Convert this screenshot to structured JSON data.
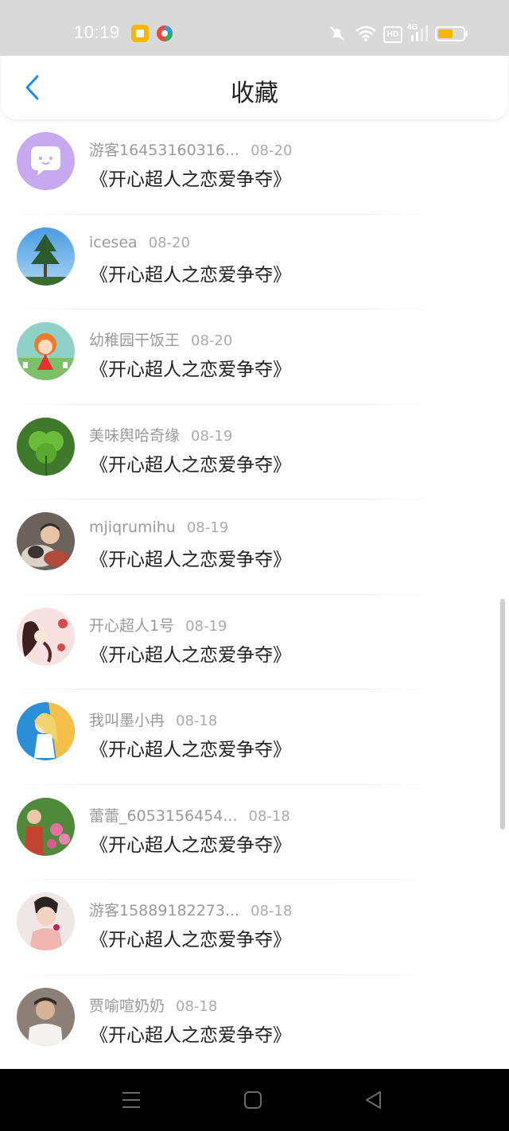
{
  "status_bar": {
    "time": "10:19",
    "hd_label": "HD",
    "network_label": "4G",
    "battery_color": "#f2b705"
  },
  "header": {
    "title": "收藏",
    "back_icon": "chevron-left-icon",
    "accent_color": "#1a8cff"
  },
  "favorites": [
    {
      "user": "游客16453160316...",
      "date": "08-20",
      "work": "《开心超人之恋爱争夺》"
    },
    {
      "user": "icesea",
      "date": "08-20",
      "work": "《开心超人之恋爱争夺》"
    },
    {
      "user": "幼稚园干饭王",
      "date": "08-20",
      "work": "《开心超人之恋爱争夺》"
    },
    {
      "user": "美味舆哈奇缘",
      "date": "08-19",
      "work": "《开心超人之恋爱争夺》"
    },
    {
      "user": "mjiqrumihu",
      "date": "08-19",
      "work": "《开心超人之恋爱争夺》"
    },
    {
      "user": "开心超人1号",
      "date": "08-19",
      "work": "《开心超人之恋爱争夺》"
    },
    {
      "user": "我叫墨小冉",
      "date": "08-18",
      "work": "《开心超人之恋爱争夺》"
    },
    {
      "user": "蕾蕾_6053156454...",
      "date": "08-18",
      "work": "《开心超人之恋爱争夺》"
    },
    {
      "user": "游客15889182273...",
      "date": "08-18",
      "work": "《开心超人之恋爱争夺》"
    },
    {
      "user": "贾喻喧奶奶",
      "date": "08-18",
      "work": "《开心超人之恋爱争夺》"
    }
  ],
  "nav_bar": {
    "menu_icon": "menu-icon",
    "home_icon": "square-home-icon",
    "back_icon": "triangle-back-icon"
  }
}
